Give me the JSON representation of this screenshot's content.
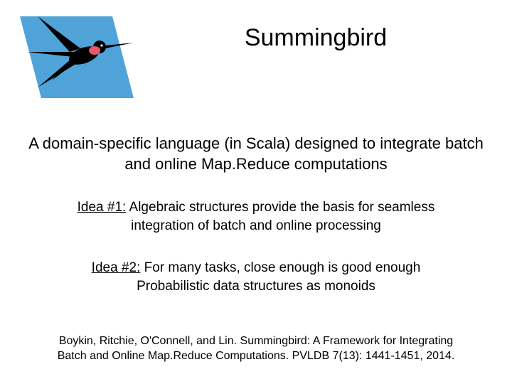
{
  "title": "Summingbird",
  "subtitle": "A domain-specific language (in Scala) designed to integrate batch and online Map.Reduce computations",
  "idea1": {
    "label": "Idea #1:",
    "text": " Algebraic structures provide the basis for seamless integration of batch and online processing"
  },
  "idea2": {
    "label": "Idea #2:",
    "text_line1": " For many tasks, close enough is good enough",
    "text_line2": "Probabilistic data structures as monoids"
  },
  "citation": "Boykin, Ritchie, O'Connell, and Lin. Summingbird: A Framework for Integrating Batch and Online Map.Reduce Computations. PVLDB 7(13): 1441-1451, 2014.",
  "logo": {
    "bg_color": "#4FA3D9",
    "bird_color": "black",
    "accent_color": "#E8566C"
  }
}
